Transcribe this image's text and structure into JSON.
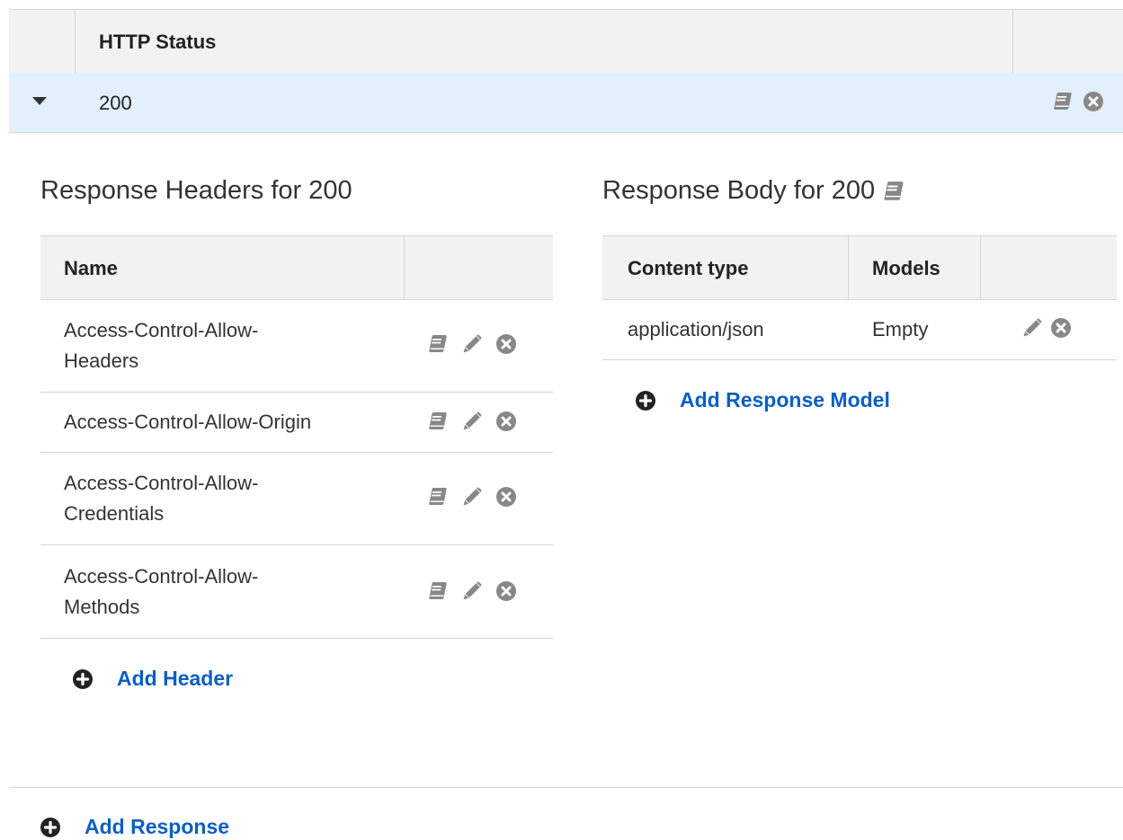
{
  "status_table": {
    "column_title": "HTTP Status",
    "row": {
      "code": "200"
    }
  },
  "headers_section": {
    "title": "Response Headers for 200",
    "column_name": "Name",
    "rows": [
      {
        "name": "Access-Control-Allow-Headers",
        "line1": "Access-Control-Allow-",
        "line2": "Headers"
      },
      {
        "name": "Access-Control-Allow-Origin",
        "line1": "Access-Control-Allow-Origin",
        "line2": ""
      },
      {
        "name": "Access-Control-Allow-Credentials",
        "line1": "Access-Control-Allow-",
        "line2": "Credentials"
      },
      {
        "name": "Access-Control-Allow-Methods",
        "line1": "Access-Control-Allow-",
        "line2": "Methods"
      }
    ],
    "add_label": "Add Header"
  },
  "body_section": {
    "title": "Response Body for 200",
    "column_content_type": "Content type",
    "column_models": "Models",
    "rows": [
      {
        "content_type": "application/json",
        "model": "Empty"
      }
    ],
    "add_label": "Add Response Model"
  },
  "footer": {
    "add_label": "Add Response"
  },
  "colors": {
    "link": "#0a5fc2",
    "selected_row": "#e1f0fa",
    "header_bg": "#f2f2f2",
    "icon_gray": "#888888"
  }
}
